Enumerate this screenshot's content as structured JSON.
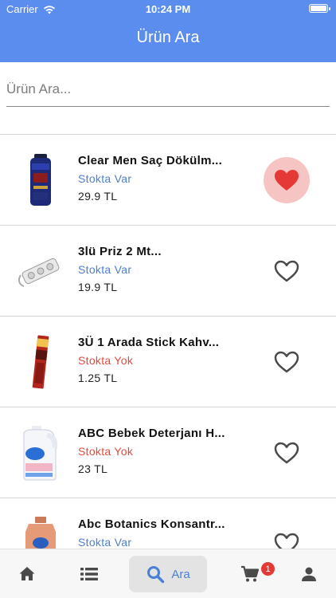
{
  "status_bar": {
    "carrier": "Carrier",
    "time": "10:24 PM",
    "icons": [
      "wifi-icon",
      "battery-icon"
    ]
  },
  "header": {
    "title": "Ürün Ara"
  },
  "search": {
    "placeholder": "Ürün Ara...",
    "value": ""
  },
  "colors": {
    "primary": "#5b8def",
    "in_stock": "#4a7fd4",
    "out_of_stock": "#e04a3e",
    "favorite": "#e53935",
    "favorite_bg": "#f6c5c3"
  },
  "products": [
    {
      "name": "Clear Men Saç Dökülm...",
      "stock": "Stokta Var",
      "price": "29.9 TL",
      "favorite": true,
      "thumb": "shampoo-bottle"
    },
    {
      "name": "3lü Priz 2 Mt...",
      "stock": "Stokta Var",
      "price": "19.9 TL",
      "favorite": false,
      "thumb": "power-strip"
    },
    {
      "name": "3Ü 1 Arada Stick Kahv...",
      "stock": "Stokta Yok",
      "price": "1.25 TL",
      "favorite": false,
      "thumb": "coffee-stick"
    },
    {
      "name": "ABC Bebek Deterjanı H...",
      "stock": "Stokta Yok",
      "price": "23 TL",
      "favorite": false,
      "thumb": "detergent-bottle"
    },
    {
      "name": "Abc Botanics Konsantr...",
      "stock": "Stokta Var",
      "price": "",
      "favorite": false,
      "thumb": "softener-bottle"
    }
  ],
  "tabbar": {
    "items": [
      {
        "icon": "home-icon"
      },
      {
        "icon": "list-icon"
      },
      {
        "icon": "search-icon",
        "label": "Ara",
        "active": true
      },
      {
        "icon": "cart-icon",
        "badge": "1"
      },
      {
        "icon": "user-icon"
      }
    ]
  }
}
